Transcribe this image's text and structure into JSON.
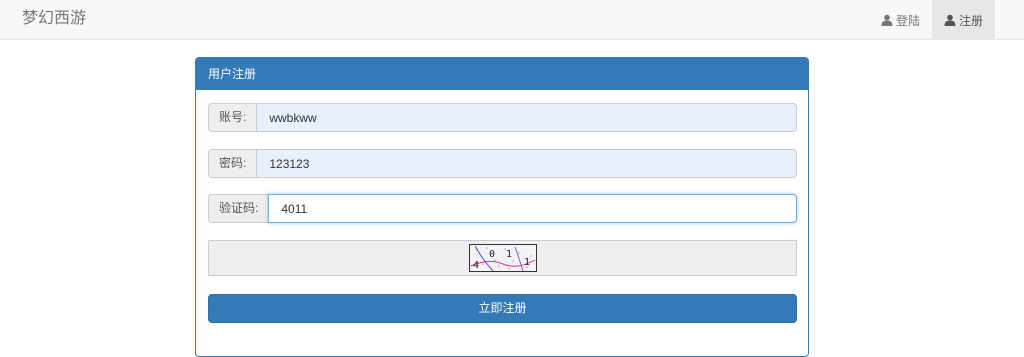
{
  "navbar": {
    "brand": "梦幻西游",
    "items": [
      {
        "label": "登陆",
        "icon": "user-icon",
        "active": false
      },
      {
        "label": "注册",
        "icon": "user-icon",
        "active": true
      }
    ]
  },
  "panel": {
    "title": "用户注册",
    "account": {
      "label": "账号:",
      "value": "wwbkww"
    },
    "password": {
      "label": "密码:",
      "value": "123123"
    },
    "captcha": {
      "label": "验证码:",
      "value": "4011"
    },
    "captcha_image_text": "4011",
    "submit_label": "立即注册"
  },
  "colors": {
    "primary": "#337ab7",
    "autofill": "#e8f0fe"
  }
}
